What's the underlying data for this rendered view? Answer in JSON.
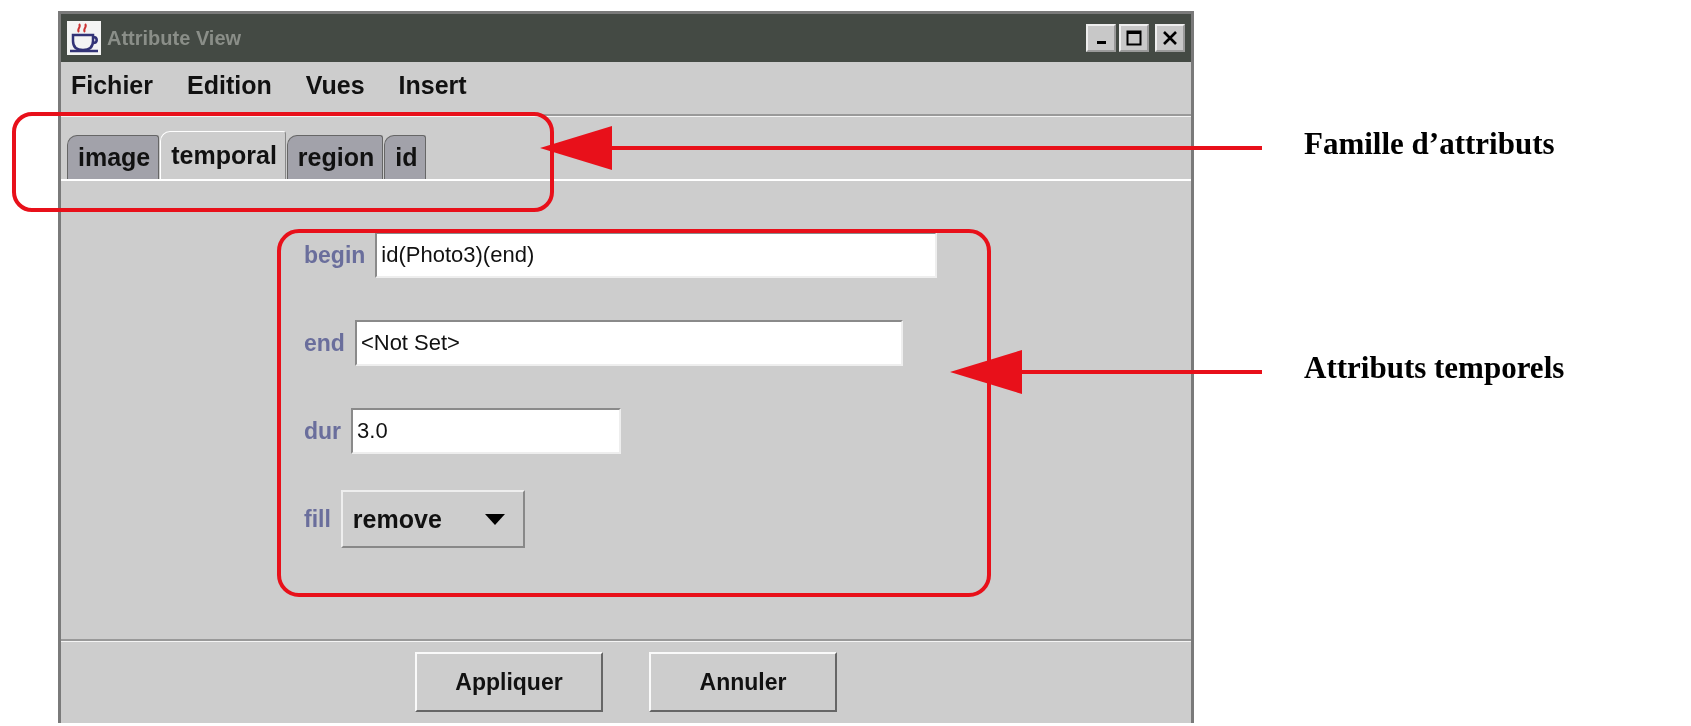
{
  "window": {
    "title": "Attribute View",
    "active": false
  },
  "menu": [
    "Fichier",
    "Edition",
    "Vues",
    "Insert"
  ],
  "tabs": [
    {
      "label": "image",
      "selected": false
    },
    {
      "label": "temporal",
      "selected": true
    },
    {
      "label": "region",
      "selected": false
    },
    {
      "label": "id",
      "selected": false
    }
  ],
  "fields": [
    {
      "label": "begin",
      "kind": "text",
      "value": "id(Photo3)(end)"
    },
    {
      "label": "end",
      "kind": "text",
      "value": "<Not Set>"
    },
    {
      "label": "dur",
      "kind": "text",
      "value": "3.0"
    },
    {
      "label": "fill",
      "kind": "dropdown",
      "value": "remove"
    }
  ],
  "buttons": [
    "Appliquer",
    "Annuler"
  ],
  "annotations": [
    {
      "text": "Famille d’attributs"
    },
    {
      "text": "Attributs temporels"
    }
  ]
}
